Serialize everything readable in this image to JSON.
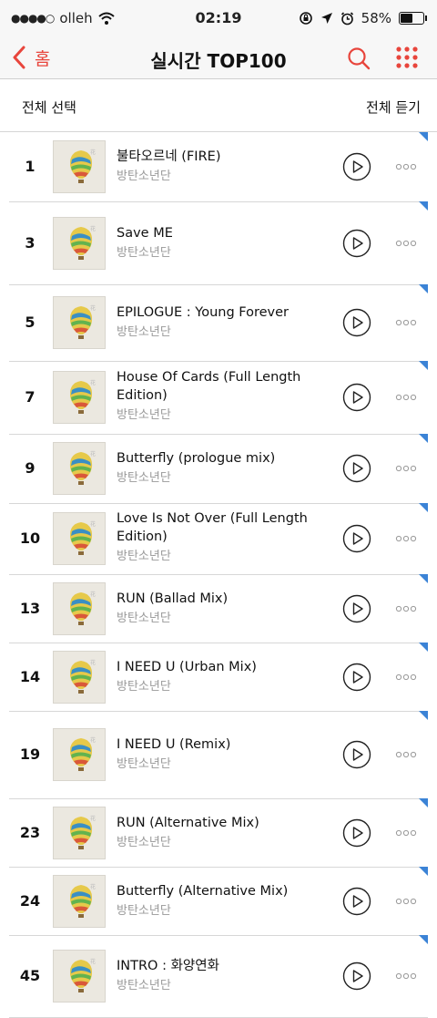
{
  "status_bar": {
    "signal_icon": "signal-dots-icon",
    "carrier": "olleh",
    "wifi_icon": "wifi-icon",
    "time": "02:19",
    "battery_percent": "58%",
    "battery_level": 0.58
  },
  "nav": {
    "back_label": "홈",
    "title": "실시간 TOP100",
    "search_icon": "search-icon",
    "menu_icon": "grid-menu-icon",
    "accent_color": "#e8453c"
  },
  "subheader": {
    "select_all": "전체 선택",
    "play_all": "전체 듣기"
  },
  "tracks": [
    {
      "rank": "1",
      "title": "불타오르네 (FIRE)",
      "artist": "방탄소년단"
    },
    {
      "rank": "3",
      "title": "Save ME",
      "artist": "방탄소년단"
    },
    {
      "rank": "5",
      "title": "EPILOGUE : Young Forever",
      "artist": "방탄소년단"
    },
    {
      "rank": "7",
      "title": "House Of Cards (Full Length Edition)",
      "artist": "방탄소년단"
    },
    {
      "rank": "9",
      "title": "Butterfly (prologue mix)",
      "artist": "방탄소년단"
    },
    {
      "rank": "10",
      "title": "Love Is Not Over (Full Length Edition)",
      "artist": "방탄소년단"
    },
    {
      "rank": "13",
      "title": "RUN (Ballad Mix)",
      "artist": "방탄소년단"
    },
    {
      "rank": "14",
      "title": "I NEED U (Urban Mix)",
      "artist": "방탄소년단"
    },
    {
      "rank": "19",
      "title": "I NEED U (Remix)",
      "artist": "방탄소년단"
    },
    {
      "rank": "23",
      "title": "RUN (Alternative Mix)",
      "artist": "방탄소년단"
    },
    {
      "rank": "24",
      "title": "Butterfly (Alternative Mix)",
      "artist": "방탄소년단"
    },
    {
      "rank": "45",
      "title": "INTRO : 화양연화",
      "artist": "방탄소년단"
    }
  ]
}
